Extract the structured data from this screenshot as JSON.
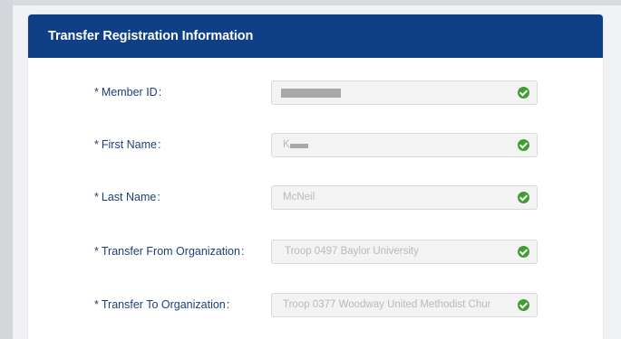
{
  "panel": {
    "title": "Transfer Registration Information"
  },
  "form": {
    "required_marker": "*",
    "colon": ":",
    "fields": [
      {
        "label": "Member ID",
        "value": "",
        "redacted": true
      },
      {
        "label": "First Name",
        "value": "K",
        "redacted": true
      },
      {
        "label": "Last Name",
        "value": "McNeil",
        "redacted": false
      },
      {
        "label": "Transfer From Organization",
        "value": "Troop 0497 Baylor University",
        "redacted": false
      },
      {
        "label": "Transfer To Organization",
        "value": "Troop 0377 Woodway United Methodist Chur",
        "redacted": false
      }
    ]
  },
  "colors": {
    "header_bg": "#0f3f86",
    "label_color": "#1d3f79",
    "valid_check": "#3f9e31"
  },
  "icons": {
    "valid": "check-circle-icon"
  }
}
